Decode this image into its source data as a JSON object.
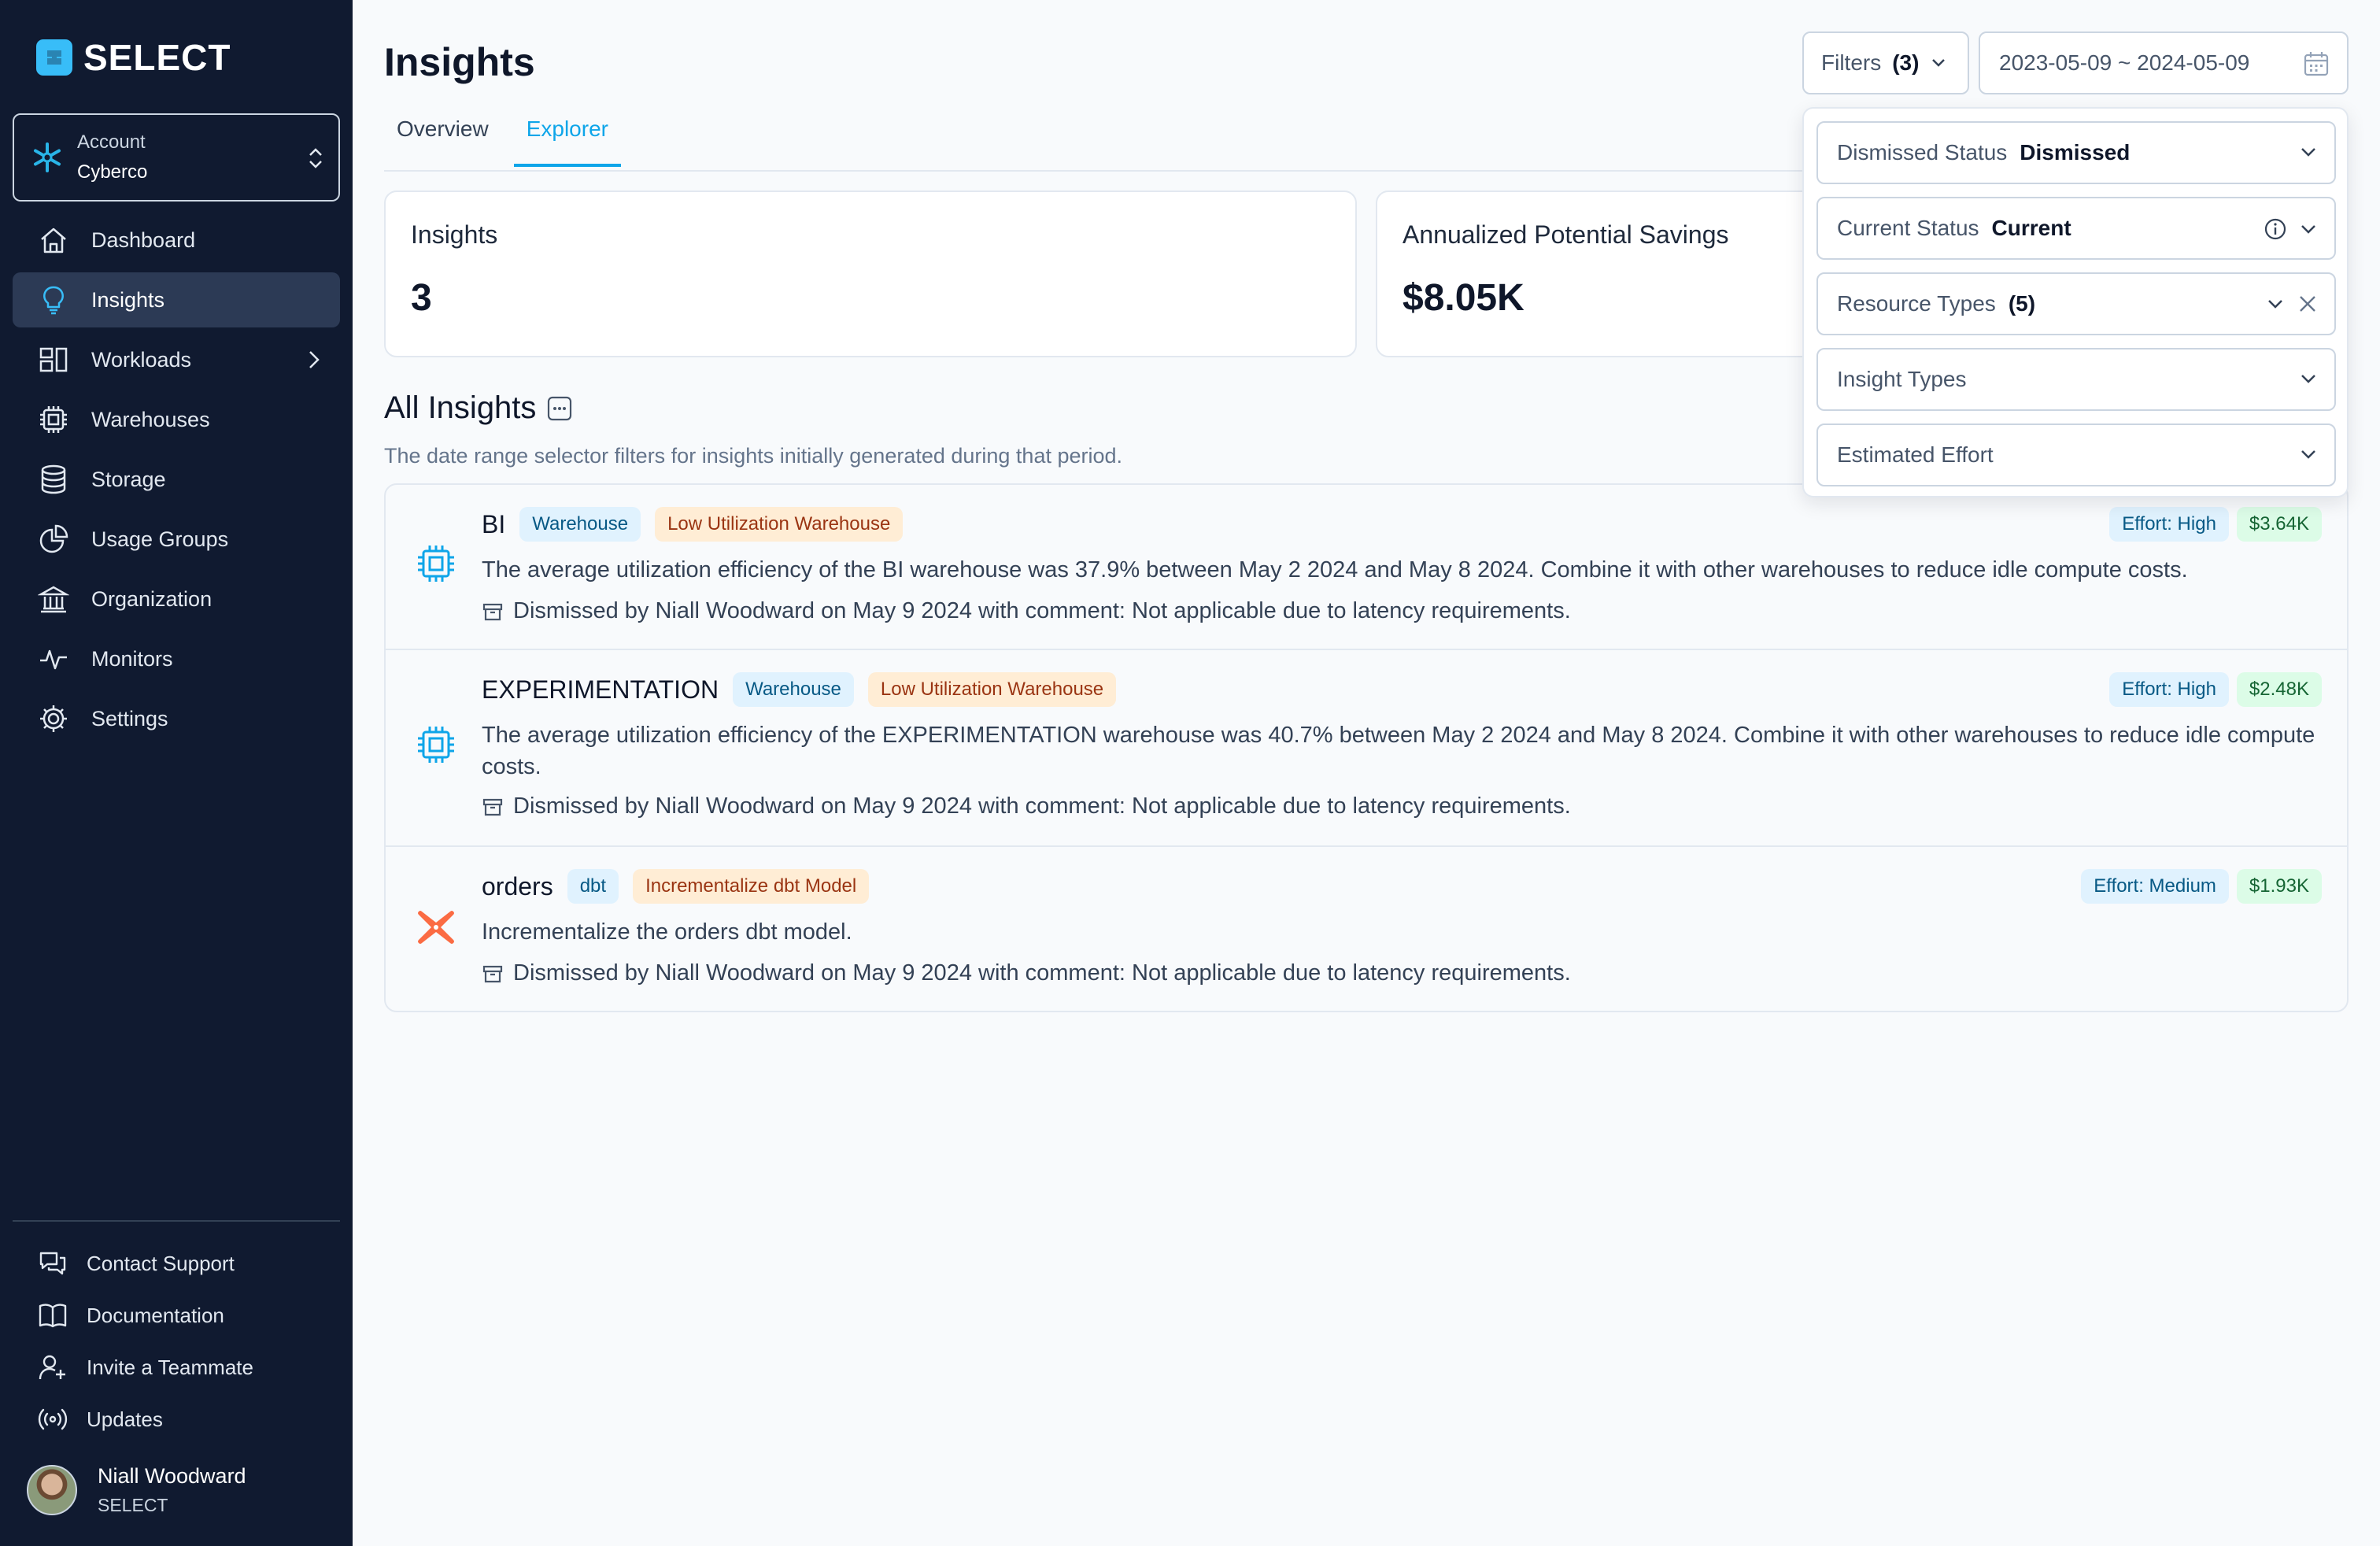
{
  "brand": {
    "name": "SELECT"
  },
  "account": {
    "label": "Account",
    "name": "Cyberco"
  },
  "sidebar": {
    "items": [
      {
        "label": "Dashboard",
        "icon": "home-icon"
      },
      {
        "label": "Insights",
        "icon": "lightbulb-icon"
      },
      {
        "label": "Workloads",
        "icon": "workloads-icon"
      },
      {
        "label": "Warehouses",
        "icon": "chip-icon"
      },
      {
        "label": "Storage",
        "icon": "database-icon"
      },
      {
        "label": "Usage Groups",
        "icon": "pie-chart-icon"
      },
      {
        "label": "Organization",
        "icon": "bank-icon"
      },
      {
        "label": "Monitors",
        "icon": "pulse-icon"
      },
      {
        "label": "Settings",
        "icon": "gear-icon"
      }
    ],
    "bottom": [
      {
        "label": "Contact Support",
        "icon": "chat-icon"
      },
      {
        "label": "Documentation",
        "icon": "book-icon"
      },
      {
        "label": "Invite a Teammate",
        "icon": "user-plus-icon"
      },
      {
        "label": "Updates",
        "icon": "broadcast-icon"
      }
    ]
  },
  "user": {
    "name": "Niall Woodward",
    "org": "SELECT"
  },
  "header": {
    "title": "Insights",
    "tabs": [
      {
        "label": "Overview"
      },
      {
        "label": "Explorer"
      }
    ],
    "filters_label": "Filters",
    "filters_count": "(3)",
    "date_range": "2023-05-09 ~ 2024-05-09"
  },
  "cards": {
    "insights": {
      "title": "Insights",
      "value": "3"
    },
    "savings": {
      "title": "Annualized Potential Savings",
      "value": "$8.05K"
    }
  },
  "section": {
    "title": "All Insights",
    "subtitle": "The date range selector filters for insights initially generated during that period."
  },
  "insights": [
    {
      "name": "BI",
      "type_badge": "Warehouse",
      "insight_badge": "Low Utilization Warehouse",
      "effort": "Effort: High",
      "savings": "$3.64K",
      "description": "The average utilization efficiency of the BI warehouse was 37.9% between May 2 2024 and May 8 2024. Combine it with other warehouses to reduce idle compute costs.",
      "note": "Dismissed by Niall Woodward on May 9 2024 with comment: Not applicable due to latency requirements."
    },
    {
      "name": "EXPERIMENTATION",
      "type_badge": "Warehouse",
      "insight_badge": "Low Utilization Warehouse",
      "effort": "Effort: High",
      "savings": "$2.48K",
      "description": "The average utilization efficiency of the EXPERIMENTATION warehouse was 40.7% between May 2 2024 and May 8 2024. Combine it with other warehouses to reduce idle compute costs.",
      "note": "Dismissed by Niall Woodward on May 9 2024 with comment: Not applicable due to latency requirements."
    },
    {
      "name": "orders",
      "type_badge": "dbt",
      "insight_badge": "Incrementalize dbt Model",
      "effort": "Effort: Medium",
      "savings": "$1.93K",
      "description": "Incrementalize the orders dbt model.",
      "note": "Dismissed by Niall Woodward on May 9 2024 with comment: Not applicable due to latency requirements."
    }
  ],
  "filter_panel": {
    "dismissed_status": {
      "label": "Dismissed Status",
      "value": "Dismissed"
    },
    "current_status": {
      "label": "Current Status",
      "value": "Current"
    },
    "resource_types": {
      "label": "Resource Types",
      "value": "(5)"
    },
    "insight_types": {
      "label": "Insight Types"
    },
    "estimated_effort": {
      "label": "Estimated Effort"
    }
  },
  "colors": {
    "sidebar_bg": "#101a30",
    "accent": "#0ea5e9",
    "dbt_orange": "#fb6b43"
  }
}
